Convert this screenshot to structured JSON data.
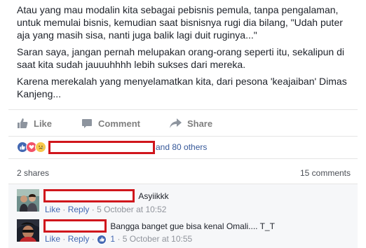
{
  "post": {
    "paragraphs": [
      "Atau yang mau modalin kita sebagai pebisnis pemula, tanpa pengalaman, untuk memulai bisnis, kemudian saat bisnisnya rugi dia bilang, \"Udah puter aja yang masih sisa, nanti juga balik lagi duit ruginya...\"",
      "Saran saya, jangan pernah melupakan orang-orang seperti itu, sekalipun di saat kita sudah jauuuhhhh lebih sukses dari mereka.",
      "Karena merekalah yang menyelamatkan kita, dari pesona 'keajaiban' Dimas Kanjeng..."
    ]
  },
  "actions": {
    "like": "Like",
    "comment": "Comment",
    "share": "Share"
  },
  "reactions": {
    "others_text": "and 80 others",
    "icons": [
      "like-icon",
      "love-icon",
      "sad-icon"
    ]
  },
  "stats": {
    "shares": "2 shares",
    "comments": "15 comments"
  },
  "comments": [
    {
      "text": "Asyiikkk",
      "meta": {
        "like": "Like",
        "sep": "·",
        "reply": "Reply",
        "time": "5 October at 10:52"
      }
    },
    {
      "text": "Bangga banget gue bisa kenal Omali.... T_T",
      "meta": {
        "like": "Like",
        "sep": "·",
        "reply": "Reply",
        "likes_count": "1",
        "time": "5 October at 10:55"
      }
    }
  ],
  "colors": {
    "link": "#365899",
    "redaction": "#d0161c",
    "like_blue": "#4267b2"
  }
}
